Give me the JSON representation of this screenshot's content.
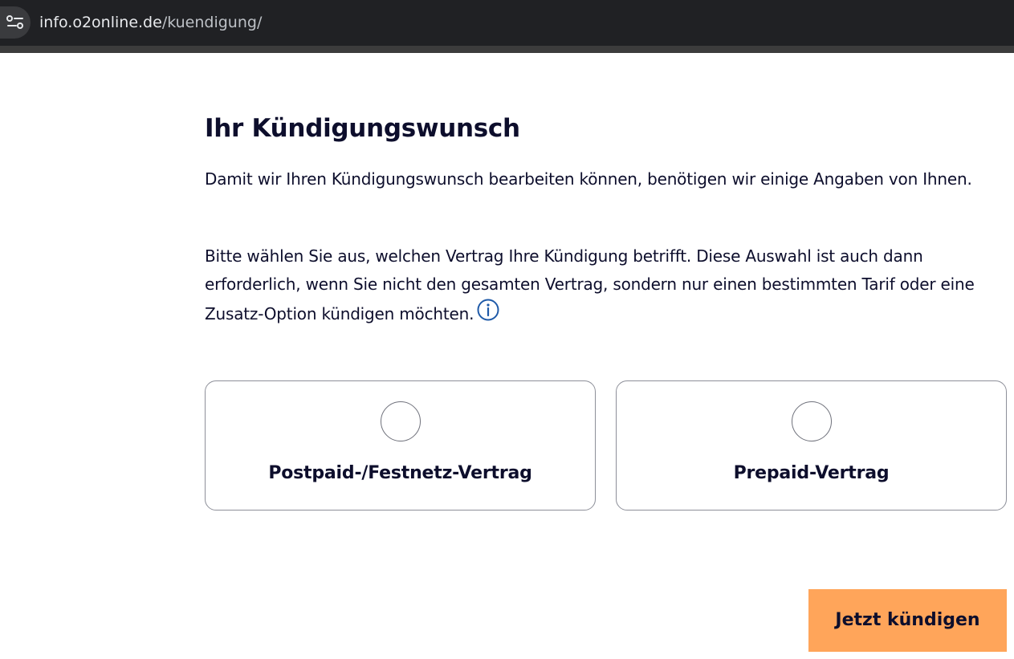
{
  "browser": {
    "url_host": "info.o2online.de",
    "url_path": "/kuendigung/"
  },
  "page": {
    "title": "Ihr Kündigungswunsch",
    "intro": "Damit wir Ihren Kündigungswunsch bearbeiten können, benötigen wir einige Angaben von Ihnen.",
    "instruction": "Bitte wählen Sie aus, welchen Vertrag Ihre Kündigung betrifft. Diese Auswahl ist auch dann erforderlich, wenn Sie nicht den gesamten Vertrag, sondern nur einen bestimmten Tarif oder eine Zusatz-Option kündigen möchten."
  },
  "options": [
    {
      "label": "Postpaid-/Festnetz-Vertrag",
      "selected": false
    },
    {
      "label": "Prepaid-Vertrag",
      "selected": false
    }
  ],
  "cta": {
    "label": "Jetzt kündigen"
  },
  "colors": {
    "cta_background": "#ffa55a",
    "text_primary": "#0d0e2c",
    "info_icon": "#1f5aa8"
  },
  "icons": {
    "site_controls": "tune-icon",
    "info": "info-icon"
  }
}
